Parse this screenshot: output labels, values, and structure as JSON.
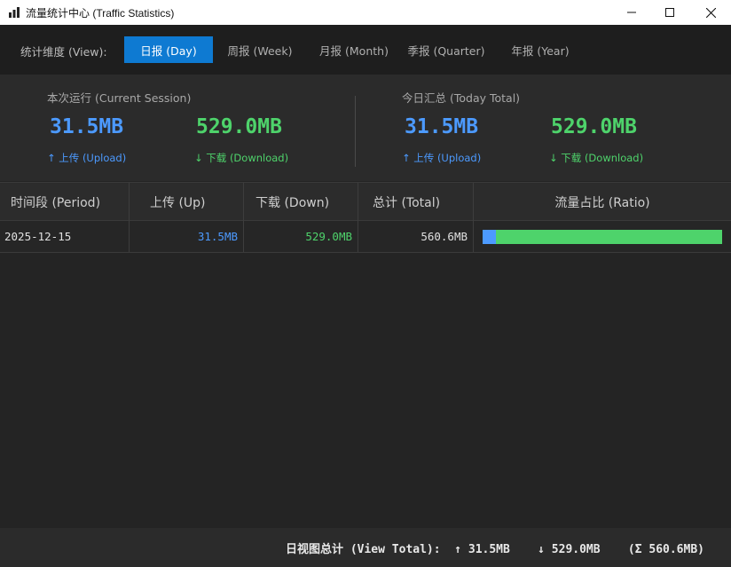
{
  "window": {
    "title": "流量统计中心 (Traffic Statistics)"
  },
  "toolbar": {
    "view_label": "统计维度 (View):",
    "tabs": [
      {
        "label": "日报 (Day)",
        "active": true
      },
      {
        "label": "周报 (Week)",
        "active": false
      },
      {
        "label": "月报 (Month)",
        "active": false
      },
      {
        "label": "季报 (Quarter)",
        "active": false
      },
      {
        "label": "年报 (Year)",
        "active": false
      }
    ]
  },
  "stats": {
    "session": {
      "title": "本次运行 (Current Session)",
      "upload": "31.5MB",
      "download": "529.0MB",
      "upload_label": "↑ 上传 (Upload)",
      "download_label": "↓ 下载 (Download)"
    },
    "today": {
      "title": "今日汇总 (Today Total)",
      "upload": "31.5MB",
      "download": "529.0MB",
      "upload_label": "↑ 上传 (Upload)",
      "download_label": "↓ 下载 (Download)"
    }
  },
  "table": {
    "headers": [
      "时间段 (Period)",
      "上传 (Up)",
      "下载 (Down)",
      "总计 (Total)",
      "流量占比 (Ratio)"
    ],
    "rows": [
      {
        "period": "2025-12-15",
        "up": "31.5MB",
        "down": "529.0MB",
        "total": "560.6MB",
        "up_ratio": 0.056
      }
    ]
  },
  "footer": {
    "summary": "日视图总计 (View Total):  ↑ 31.5MB    ↓ 529.0MB    (Σ 560.6MB)"
  },
  "colors": {
    "accent": "#0e7ad2",
    "upload": "#4c9aff",
    "download": "#4ed36b"
  }
}
